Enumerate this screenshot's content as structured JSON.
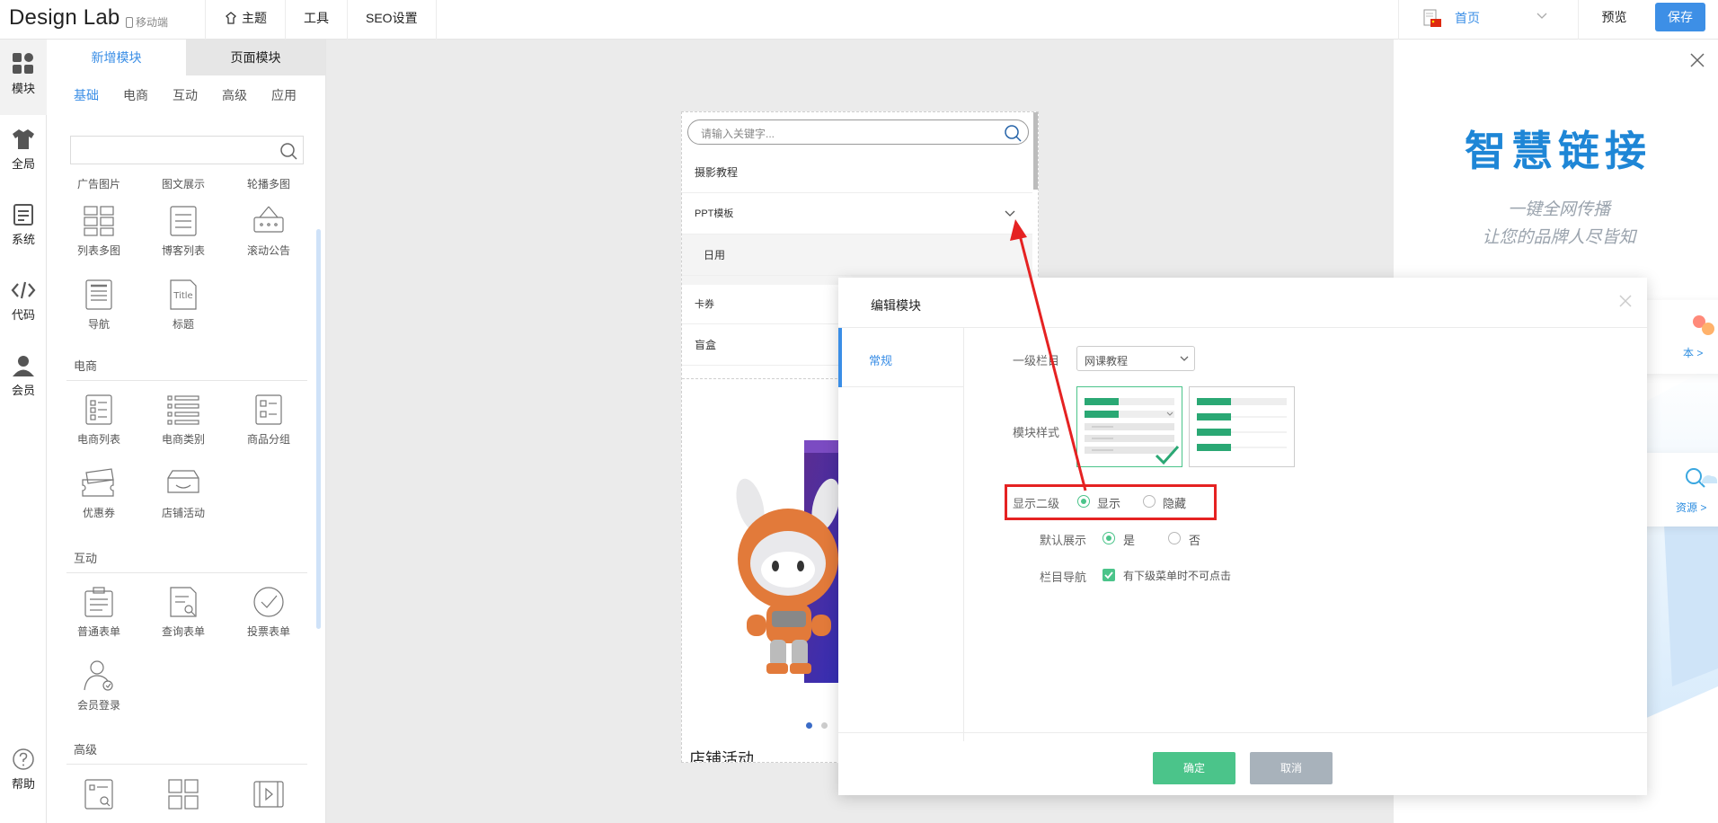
{
  "topbar": {
    "logo": "Design Lab",
    "mobile": "移动端",
    "nav": [
      "主题",
      "工具",
      "SEO设置"
    ],
    "home": "首页",
    "preview": "预览",
    "save": "保存"
  },
  "rail": [
    "模块",
    "全局",
    "系统",
    "代码",
    "会员",
    "帮助"
  ],
  "panel": {
    "tabs": [
      "新增模块",
      "页面模块"
    ],
    "categories": [
      "基础",
      "电商",
      "互动",
      "高级",
      "应用"
    ],
    "top_row": [
      "广告图片",
      "图文展示",
      "轮播多图"
    ],
    "basic": [
      "列表多图",
      "博客列表",
      "滚动公告",
      "导航",
      "标题"
    ],
    "ecommerce_title": "电商",
    "ecommerce": [
      "电商列表",
      "电商类别",
      "商品分组",
      "优惠券",
      "店铺活动"
    ],
    "interact_title": "互动",
    "interact": [
      "普通表单",
      "查询表单",
      "投票表单",
      "会员登录"
    ],
    "advanced_title": "高级"
  },
  "phone": {
    "search_placeholder": "请输入关键字...",
    "menu": [
      "摄影教程",
      "PPT模板",
      "日用",
      "卡券",
      "盲盒"
    ],
    "store_title": "店铺活动"
  },
  "promo": {
    "title": "智慧链接",
    "sub1": "一键全网传播",
    "sub2": "让您的品牌人尽皆知",
    "card1": "本 >",
    "card2": "资源 >"
  },
  "modal": {
    "title": "编辑模块",
    "tab": "常规",
    "level1_label": "一级栏目",
    "level1_value": "网课教程",
    "style_label": "模块样式",
    "show2_label": "显示二级",
    "show": "显示",
    "hide": "隐藏",
    "default_label": "默认展示",
    "yes": "是",
    "no": "否",
    "nav_label": "栏目导航",
    "nav_check": "有下级菜单时不可点击",
    "ok": "确定",
    "cancel": "取消"
  },
  "colors": {
    "accent": "#3a8ee6",
    "green": "#4bc48a",
    "red": "#e52222"
  }
}
